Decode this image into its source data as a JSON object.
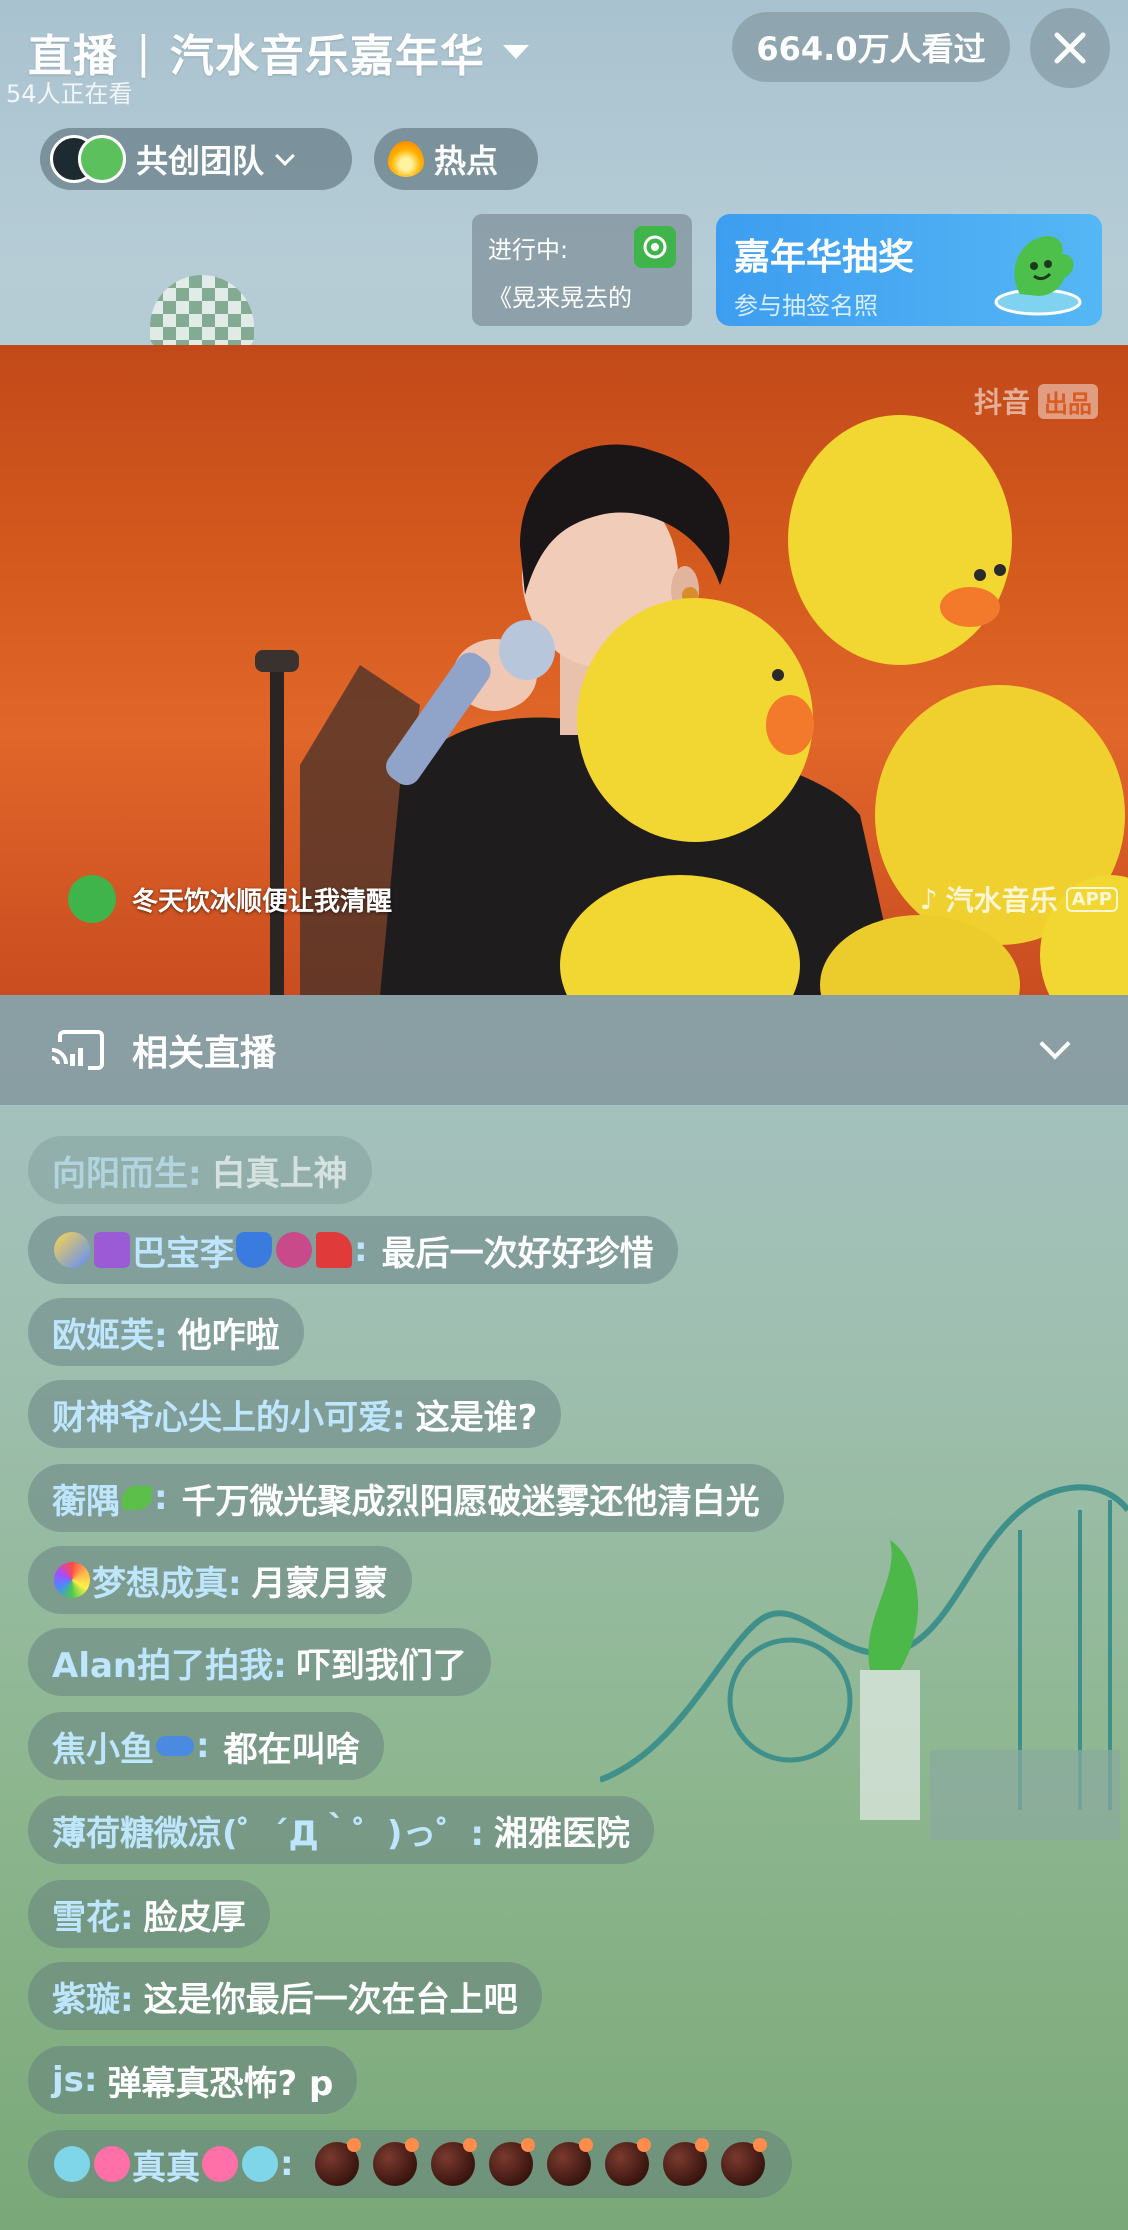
{
  "header": {
    "live_label": "直播",
    "separator": "|",
    "room_name": "汽水音乐嘉年华",
    "watching_now": "54人正在看",
    "total_views": "664.0万人看过",
    "close_icon": "close-icon"
  },
  "chips": {
    "team_label": "共创团队",
    "hot_label": "热点"
  },
  "now_playing": {
    "status_label": "进行中:",
    "song": "《晃来晃去的"
  },
  "lottery": {
    "title": "嘉年华抽奖",
    "subtitle": "参与抽签名照"
  },
  "video": {
    "watermark_top": "抖音",
    "watermark_tag": "出品",
    "caption": "冬天饮冰顺便让我清醒",
    "watermark_app": "汽水音乐",
    "watermark_app_badge": "APP"
  },
  "related": {
    "label": "相关直播"
  },
  "comments": [
    {
      "name": "向阳而生:",
      "text": "白真上神"
    },
    {
      "name": "巴宝李",
      "text": "最后一次好好珍惜"
    },
    {
      "name": "欧姬芙:",
      "text": "他咋啦"
    },
    {
      "name": "财神爷心尖上的小可爱:",
      "text": "这是谁?"
    },
    {
      "name": "蘅隅",
      "text": "千万微光聚成烈阳愿破迷雾还他清白光"
    },
    {
      "name": "梦想成真:",
      "text": "月蒙月蒙"
    },
    {
      "name": "Alan拍了拍我:",
      "text": "吓到我们了"
    },
    {
      "name": "焦小鱼",
      "text": "都在叫啥"
    },
    {
      "name": "薄荷糖微凉(゜´Д｀゜)っ゜:",
      "text": "湘雅医院"
    },
    {
      "name": "雪花:",
      "text": "脸皮厚"
    },
    {
      "name": "紫璇:",
      "text": "这是你最后一次在台上吧"
    },
    {
      "name": "js:",
      "text": "弹幕真恐怖? p"
    },
    {
      "name": "真真",
      "text": ""
    }
  ],
  "colors": {
    "username": "#bfe6ff",
    "lottery_bg": "#3d9df0",
    "brand_green": "#3fb44a",
    "stage_orange": "#d55a1e",
    "balloon_yellow": "#f2d632"
  }
}
